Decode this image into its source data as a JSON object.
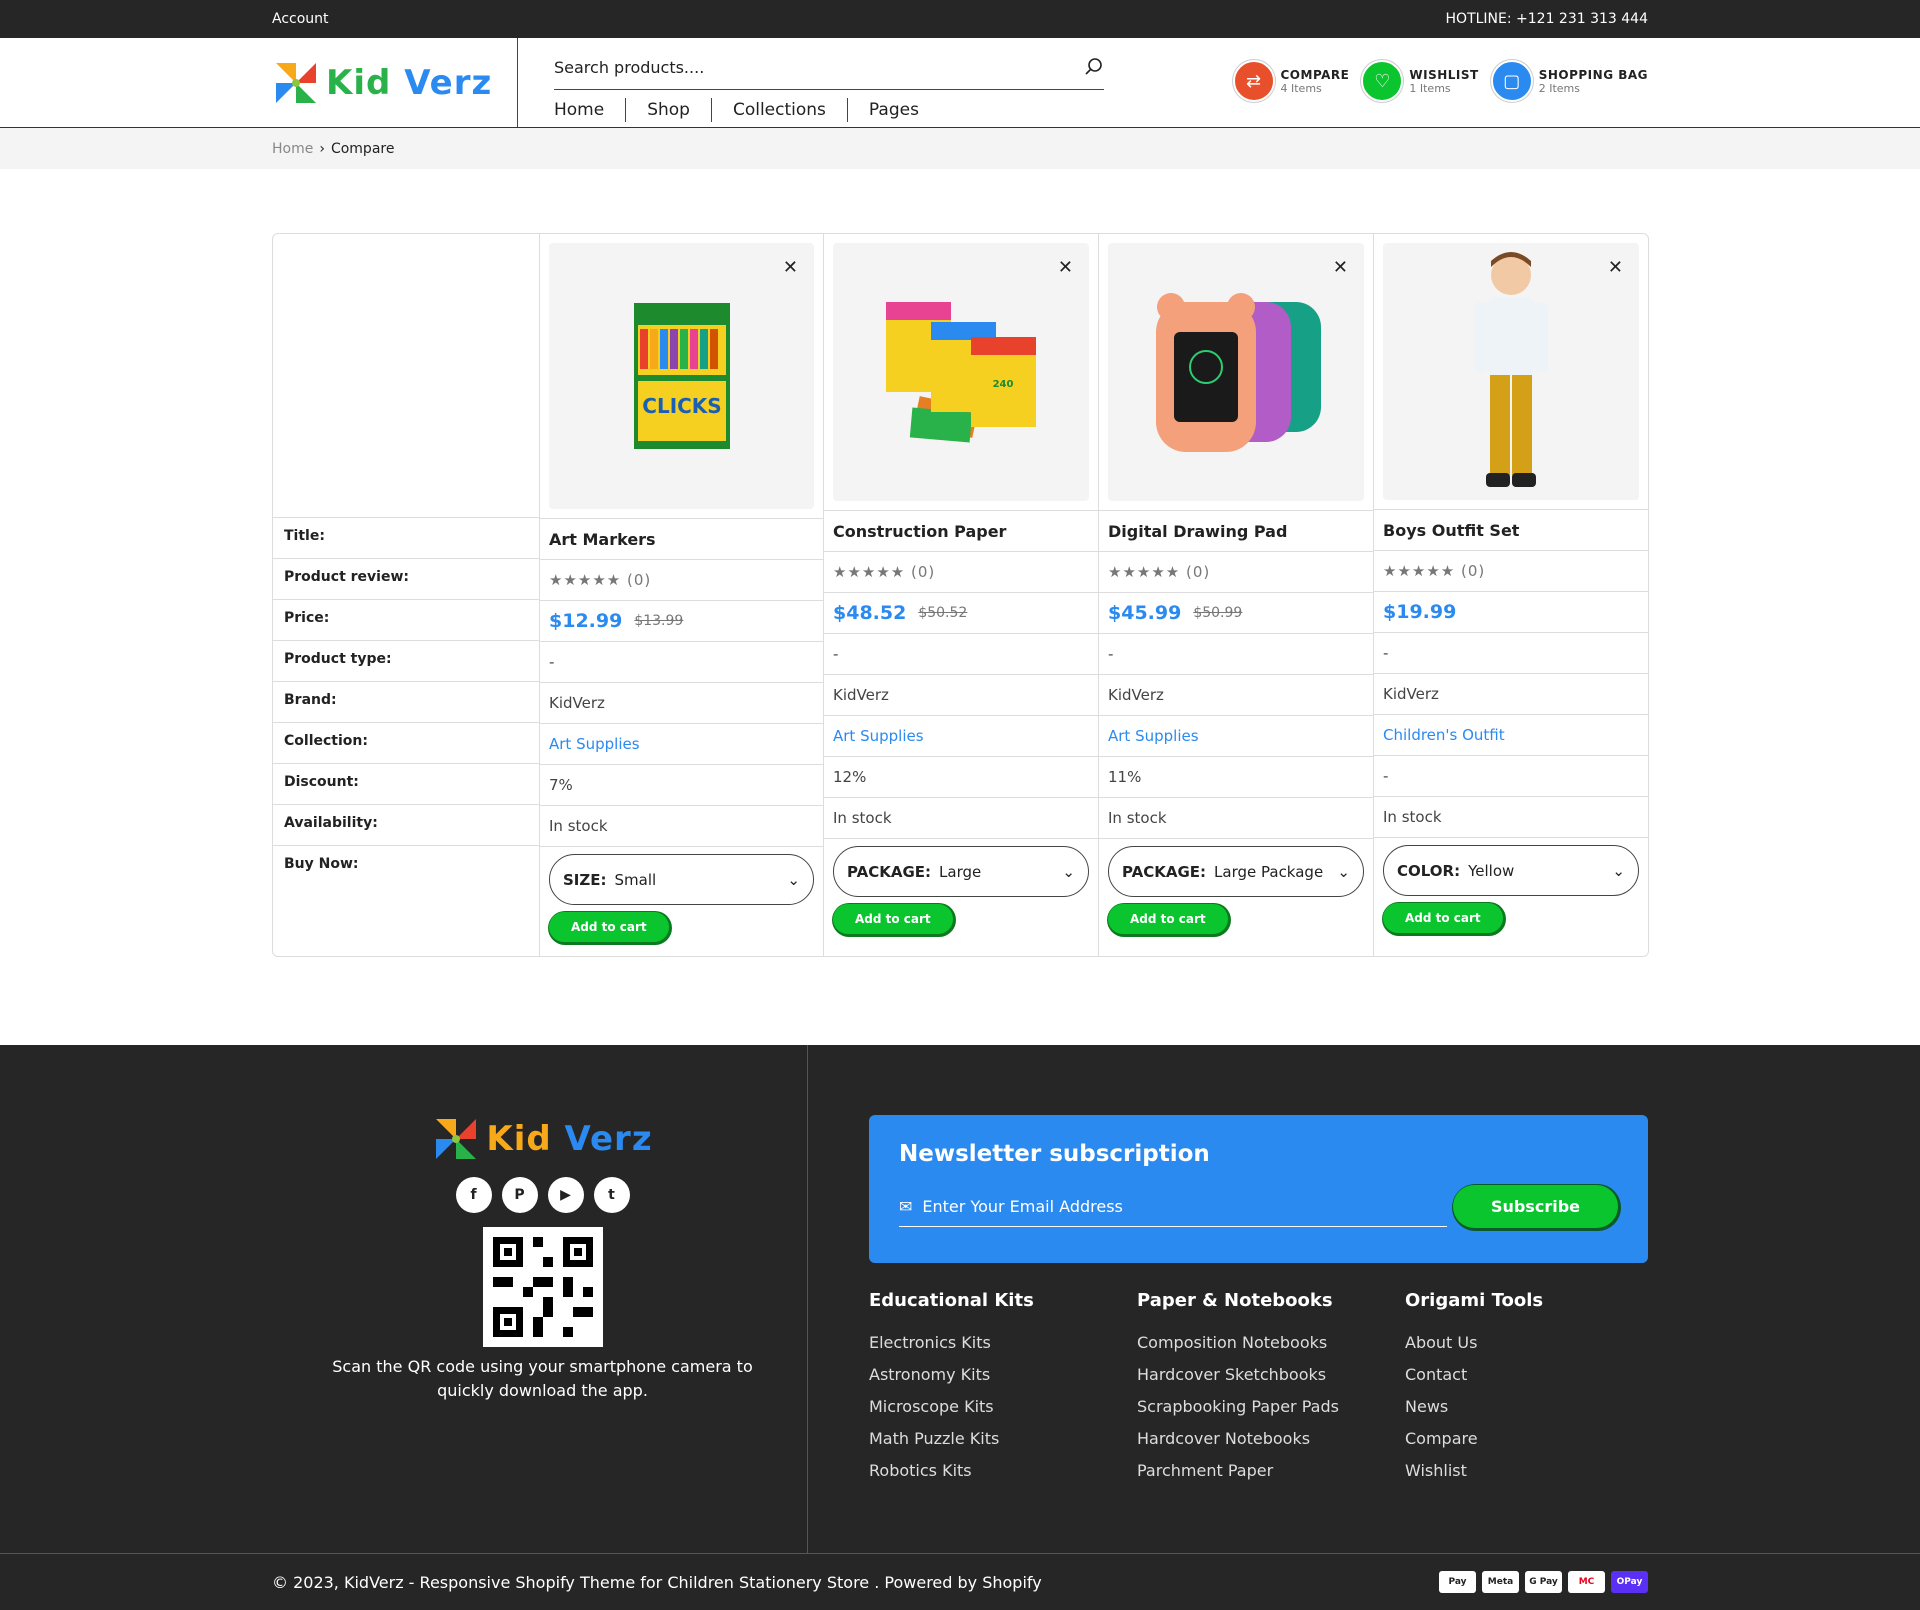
{
  "topbar": {
    "account": "Account",
    "hotline": "HOTLINE: +121 231 313 444"
  },
  "brand": {
    "name_a": "Kid",
    "name_b": "Verz"
  },
  "search": {
    "placeholder": "Search products...."
  },
  "nav": [
    "Home",
    "Shop",
    "Collections",
    "Pages"
  ],
  "header_icons": [
    {
      "label": "COMPARE",
      "count": "4 Items",
      "color": "#e8502c",
      "icon": "compare-icon"
    },
    {
      "label": "WISHLIST",
      "count": "1 Items",
      "color": "#0bc52f",
      "icon": "heart-icon"
    },
    {
      "label": "SHOPPING BAG",
      "count": "2 Items",
      "color": "#2b8af0",
      "icon": "bag-icon"
    }
  ],
  "breadcrumb": {
    "home": "Home",
    "current": "Compare"
  },
  "compare": {
    "row_labels": [
      "Title:",
      "Product review:",
      "Price:",
      "Product type:",
      "Brand:",
      "Collection:",
      "Discount:",
      "Availability:",
      "Buy Now:"
    ],
    "products": [
      {
        "title": "Art Markers",
        "review": "★★★★★ (0)",
        "price": "$12.99",
        "old_price": "$13.99",
        "type": "-",
        "brand": "KidVerz",
        "collection": "Art Supplies",
        "discount": "7%",
        "availability": "In stock",
        "option_label": "SIZE:",
        "option_value": "Small",
        "cart": "Add to cart"
      },
      {
        "title": "Construction Paper",
        "review": "★★★★★ (0)",
        "price": "$48.52",
        "old_price": "$50.52",
        "type": "-",
        "brand": "KidVerz",
        "collection": "Art Supplies",
        "discount": "12%",
        "availability": "In stock",
        "option_label": "PACKAGE:",
        "option_value": "Large",
        "cart": "Add to cart"
      },
      {
        "title": "Digital Drawing Pad",
        "review": "★★★★★ (0)",
        "price": "$45.99",
        "old_price": "$50.99",
        "type": "-",
        "brand": "KidVerz",
        "collection": "Art Supplies",
        "discount": "11%",
        "availability": "In stock",
        "option_label": "PACKAGE:",
        "option_value": "Large Package",
        "cart": "Add to cart"
      },
      {
        "title": "Boys Outfit Set",
        "review": "★★★★★ (0)",
        "price": "$19.99",
        "old_price": "",
        "type": "-",
        "brand": "KidVerz",
        "collection": "Children's Outfit",
        "discount": "-",
        "availability": "In stock",
        "option_label": "COLOR:",
        "option_value": "Yellow",
        "cart": "Add to cart"
      }
    ]
  },
  "footer": {
    "qr_text": "Scan the QR code using your smartphone camera to quickly download the app.",
    "newsletter_title": "Newsletter subscription",
    "email_placeholder": "Enter Your Email Address",
    "subscribe": "Subscribe",
    "columns": [
      {
        "title": "Educational Kits",
        "links": [
          "Electronics Kits",
          "Astronomy Kits",
          "Microscope Kits",
          "Math Puzzle Kits",
          "Robotics Kits"
        ]
      },
      {
        "title": "Paper & Notebooks",
        "links": [
          "Composition Notebooks",
          "Hardcover Sketchbooks",
          "Scrapbooking Paper Pads",
          "Hardcover Notebooks",
          "Parchment Paper"
        ]
      },
      {
        "title": "Origami Tools",
        "links": [
          "About Us",
          "Contact",
          "News",
          "Compare",
          "Wishlist"
        ]
      }
    ],
    "copyright": "© 2023, KidVerz - Responsive Shopify Theme for Children Stationery Store . Powered by Shopify",
    "payments": [
      "Pay",
      "Meta",
      "G Pay",
      "MC",
      "OPay"
    ]
  }
}
